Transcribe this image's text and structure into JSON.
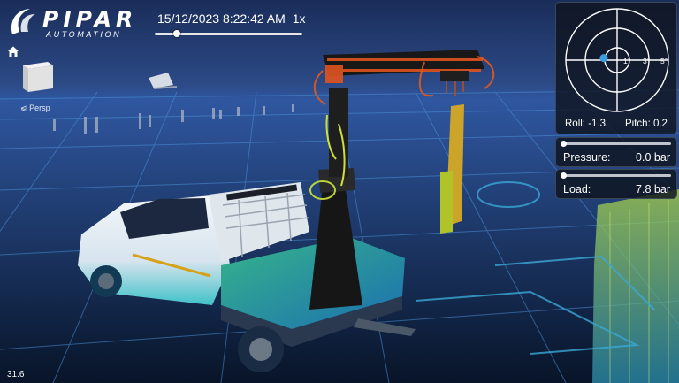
{
  "brand": {
    "name": "PIPAR",
    "tagline": "AUTOMATION"
  },
  "toolbar": {
    "home_icon": "home-icon"
  },
  "playback": {
    "timestamp": "15/12/2023 8:22:42 AM",
    "speed": "1x",
    "progress": 0.15
  },
  "view": {
    "cube_icon": "view-cube-icon",
    "projection_label": "Persp"
  },
  "status": {
    "fps": "31.6"
  },
  "inclinometer": {
    "roll_label": "Roll:",
    "roll_value": "-1.3",
    "pitch_label": "Pitch:",
    "pitch_value": "0.2",
    "ring_labels": [
      "1°",
      "3°",
      "5°"
    ]
  },
  "pressure": {
    "label": "Pressure:",
    "value": "0.0",
    "unit": "bar",
    "fraction": 0.0
  },
  "load": {
    "label": "Load:",
    "value": "7.8",
    "unit": "bar",
    "fraction": 0.0
  },
  "colors": {
    "sky": "#2c4a86",
    "ground": "#0c1733",
    "grid": "#4a90d8",
    "crane": "#e0531e",
    "accent": "#3aa0e0"
  }
}
